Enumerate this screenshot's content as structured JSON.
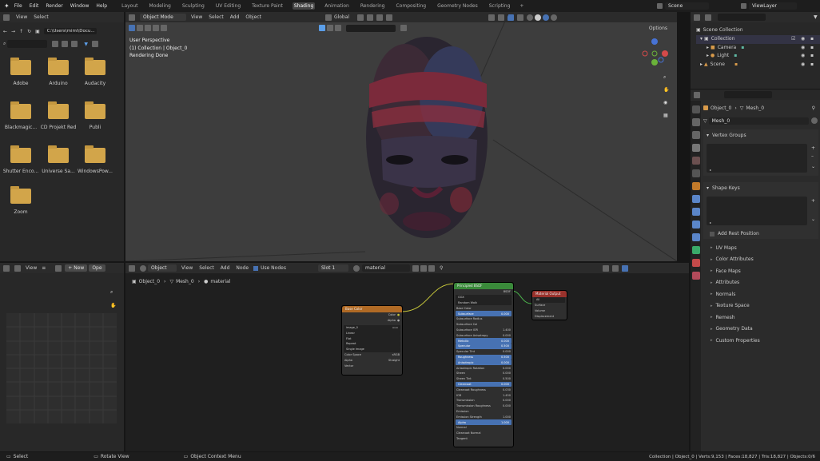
{
  "topbar": {
    "menus": [
      "File",
      "Edit",
      "Render",
      "Window",
      "Help"
    ],
    "workspaces": [
      "Layout",
      "Modeling",
      "Sculpting",
      "UV Editing",
      "Texture Paint",
      "Shading",
      "Animation",
      "Rendering",
      "Compositing",
      "Geometry Nodes",
      "Scripting"
    ],
    "active_workspace": "Shading",
    "scene": "Scene",
    "view_layer": "ViewLayer"
  },
  "file_browser": {
    "menus": [
      "View",
      "Select"
    ],
    "path": "C:\\Users\\mimi\\Docu...",
    "folders": [
      "Adobe",
      "Arduino",
      "Audacity",
      "Blackmagic...",
      "CD Projekt Red",
      "Publi",
      "Shutter Enco...",
      "Universe Sa...",
      "WindowsPow...",
      "Zoom"
    ]
  },
  "viewport": {
    "mode": "Object Mode",
    "menus": [
      "View",
      "Select",
      "Add",
      "Object"
    ],
    "transform": "Global",
    "info_lines": [
      "User Perspective",
      "(1) Collection | Object_0",
      "Rendering Done"
    ],
    "options_label": "Options"
  },
  "image_editor": {
    "view_label": "View",
    "new_label": "New",
    "open_label": "Ope"
  },
  "node_editor": {
    "object_label": "Object",
    "menus": [
      "View",
      "Select",
      "Add",
      "Node"
    ],
    "use_nodes_label": "Use Nodes",
    "slot": "Slot 1",
    "material": "material",
    "breadcrumb": [
      "Object_0",
      "Mesh_0",
      "material"
    ],
    "image_node": {
      "title": "Base Color",
      "outputs": [
        "Color",
        "Alpha"
      ],
      "image": "image_0",
      "rows": [
        "Linear",
        "Flat",
        "Repeat",
        "Single Image",
        "Color Space",
        "Alpha",
        "Vector"
      ],
      "rows_values": [
        "",
        "",
        "",
        "",
        "sRGB",
        "Straight",
        ""
      ]
    },
    "bsdf_node": {
      "title": "Principled BSDF",
      "output": "BSDF",
      "rows": [
        "GGX",
        "Random Walk",
        "Base Color",
        "Subsurface",
        "Subsurface Radius",
        "Subsurface Col",
        "Subsurface IOR",
        "Subsurface Anisotropy",
        "Metallic",
        "Specular",
        "Specular Tint",
        "Roughness",
        "Anisotropic",
        "Anisotropic Rotation",
        "Sheen",
        "Sheen Tint",
        "Clearcoat",
        "Clearcoat Roughness",
        "IOR",
        "Transmission",
        "Transmission Roughness",
        "Emission",
        "Emission Strength",
        "Alpha",
        "Normal",
        "Clearcoat Normal",
        "Tangent"
      ],
      "values": [
        "",
        "",
        "",
        "0.000",
        "",
        "",
        "1.400",
        "0.000",
        "0.000",
        "0.500",
        "0.000",
        "0.500",
        "0.000",
        "0.000",
        "0.000",
        "0.500",
        "0.000",
        "0.030",
        "1.450",
        "0.000",
        "0.000",
        "",
        "1.000",
        "1.000",
        "",
        "",
        ""
      ]
    },
    "output_node": {
      "title": "Material Output",
      "target": "All",
      "inputs": [
        "Surface",
        "Volume",
        "Displacement"
      ]
    }
  },
  "outliner": {
    "title": "Scene Collection",
    "items": [
      {
        "label": "Collection"
      },
      {
        "label": "Camera"
      },
      {
        "label": "Light"
      },
      {
        "label": "Scene"
      }
    ]
  },
  "properties": {
    "object": "Object_0",
    "mesh": "Mesh_0",
    "datablock": "Mesh_0",
    "panels": [
      "Vertex Groups",
      "Shape Keys"
    ],
    "add_rest_position": "Add Rest Position",
    "collapsed": [
      "UV Maps",
      "Color Attributes",
      "Face Maps",
      "Attributes",
      "Normals",
      "Texture Space",
      "Remesh",
      "Geometry Data",
      "Custom Properties"
    ]
  },
  "statusbar": {
    "left": [
      "Select",
      "Rotate View",
      "Object Context Menu"
    ],
    "right": "Collection | Object_0 | Verts:9,153 | Faces:18,827 | Tris:18,827 | Objects:0/6"
  },
  "colors": {
    "accent": "#4772b3",
    "folder": "#d2a54a",
    "shader_node": "#3f8b3f",
    "texture_node": "#c27a2a",
    "output_node": "#a0352f"
  }
}
